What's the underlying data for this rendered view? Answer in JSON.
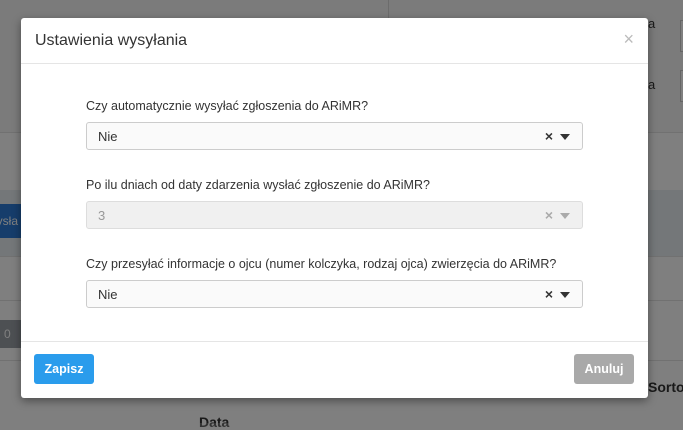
{
  "background": {
    "blue_tab": "wysła",
    "gray_box": "0",
    "right_text_1": "a",
    "right_text_2": "a",
    "right_bottom": "Sorto",
    "bottom_label": "Data"
  },
  "modal": {
    "title": "Ustawienia wysyłania",
    "close_glyph": "×",
    "fields": [
      {
        "label": "Czy automatycznie wysyłać zgłoszenia do ARiMR?",
        "value": "Nie",
        "disabled": false
      },
      {
        "label": "Po ilu dniach od daty zdarzenia wysłać zgłoszenie do ARiMR?",
        "value": "3",
        "disabled": true
      },
      {
        "label": "Czy przesyłać informacje o ojcu (numer kolczyka, rodzaj ojca) zwierzęcia do ARiMR?",
        "value": "Nie",
        "disabled": false
      }
    ],
    "clear_glyph": "×",
    "save_label": "Zapisz",
    "cancel_label": "Anuluj"
  },
  "colors": {
    "primary": "#2a9cec",
    "secondary": "#a9a9a9",
    "overlay": "rgba(0,0,0,0.5)"
  }
}
